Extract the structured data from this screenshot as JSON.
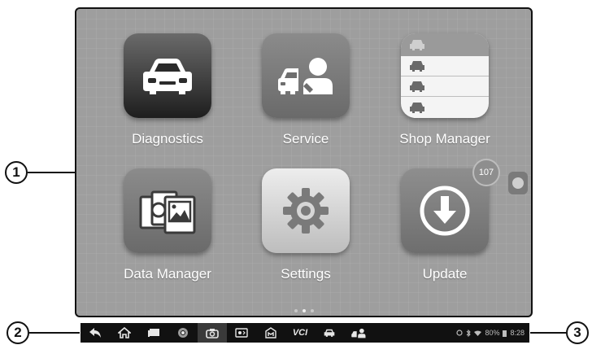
{
  "callouts": {
    "one": "1",
    "two": "2",
    "three": "3"
  },
  "apps": [
    {
      "label": "Diagnostics",
      "icon": "car-icon"
    },
    {
      "label": "Service",
      "icon": "car-technician-icon"
    },
    {
      "label": "Shop Manager",
      "icon": "car-list-icon"
    },
    {
      "label": "Data Manager",
      "icon": "image-files-icon"
    },
    {
      "label": "Settings",
      "icon": "gear-icon"
    },
    {
      "label": "Update",
      "icon": "download-icon",
      "badge": "107"
    }
  ],
  "taskbar": {
    "buttons": [
      "back-icon",
      "home-icon",
      "recent-apps-icon",
      "chrome-icon",
      "camera-icon",
      "screen-light-icon",
      "maxifix-icon",
      "vci-icon",
      "car-icon",
      "service-icon"
    ],
    "vcl_label": "VCI",
    "status": {
      "battery": "80%",
      "time": "8:28"
    }
  },
  "colors": {
    "taskbar": "#111111",
    "screen": "#9e9e9e",
    "label": "#ffffff"
  }
}
